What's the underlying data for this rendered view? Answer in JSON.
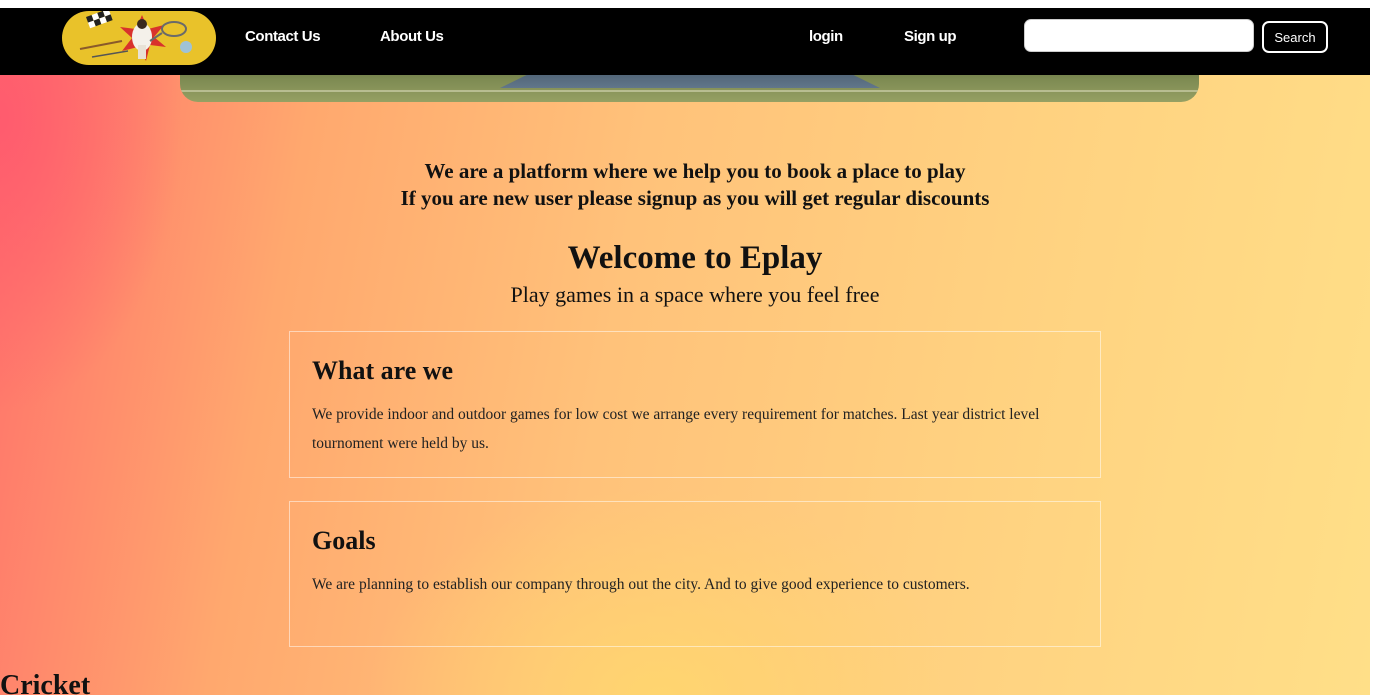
{
  "nav": {
    "logo_icon": "sports-collage-logo-icon",
    "links": {
      "contact": "Contact Us",
      "about": "About Us",
      "login": "login",
      "signup": "Sign up"
    },
    "search": {
      "placeholder": "",
      "value": "",
      "button_label": "Search"
    }
  },
  "intro": {
    "line1": "We are a platform where we help you to book a place to play",
    "line2": "If you are new user please signup as you will get regular discounts"
  },
  "welcome": {
    "title": "Welcome to Eplay",
    "subtitle": "Play games in a space where you feel free"
  },
  "cards": [
    {
      "title": "What are we",
      "text": "We provide indoor and outdoor games for low cost we arrange every requirement for matches. Last year district level tournoment were held by us."
    },
    {
      "title": "Goals",
      "text": "We are planning to establish our company through out the city. And to give good experience to customers."
    }
  ],
  "sections": {
    "cricket_title": "Cricket"
  },
  "colors": {
    "nav_background": "#000000",
    "logo_background": "#e9c22a",
    "gradient_left": "#ff6f6a",
    "gradient_right": "#ffdf88"
  }
}
